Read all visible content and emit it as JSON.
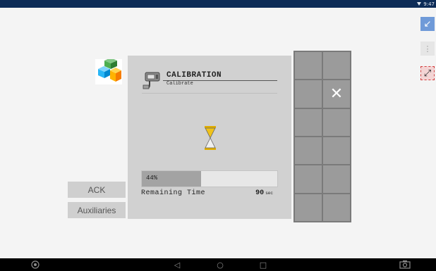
{
  "status_bar": {
    "time": "9:47",
    "wifi_icon": "wifi-icon"
  },
  "side_buttons": {
    "minimize": "↙",
    "menu": "⋮",
    "resize": "⤢"
  },
  "soft_keys": {
    "ack": "ACK",
    "auxiliaries": "Auxiliaries"
  },
  "dialog": {
    "title": "CALIBRATION",
    "subtitle": "Calibrate",
    "progress_percent": 44,
    "progress_label": "44%",
    "remaining_label": "Remaining Time",
    "remaining_value": "90",
    "remaining_unit": "sec"
  },
  "key_grid": {
    "close_symbol": "✕"
  },
  "nav_bar": {
    "back": "◁",
    "home": "○",
    "recents": "□"
  },
  "colors": {
    "status_bar": "#0d2c57",
    "hourglass_sand": "#f0c21a",
    "progress_fill": "#a3a3a3"
  }
}
